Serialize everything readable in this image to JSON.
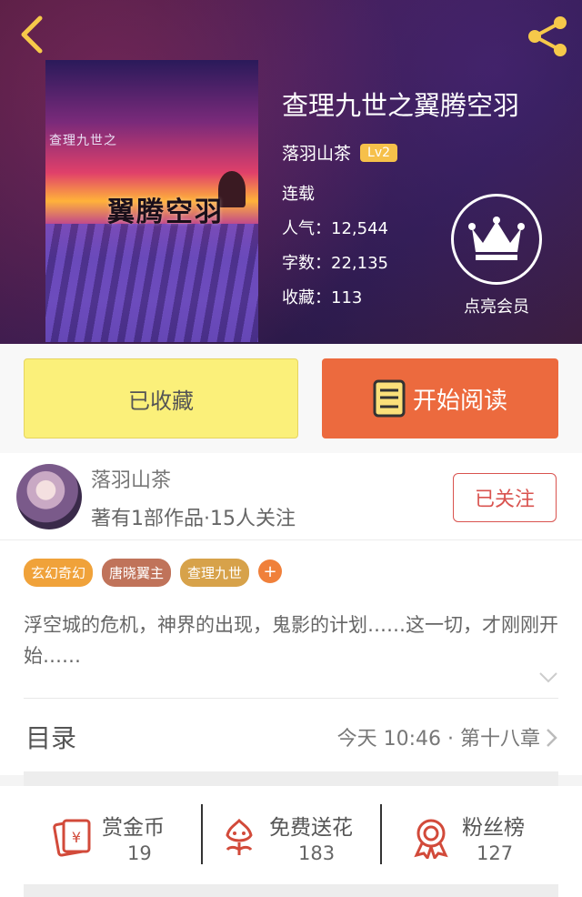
{
  "header": {
    "back_icon": "chevron-left-icon",
    "share_icon": "share-icon"
  },
  "book": {
    "cover_subtitle": "查理九世之",
    "cover_title": "翼腾空羽",
    "title": "查理九世之翼腾空羽",
    "author": "落羽山茶",
    "level": "Lv2",
    "status": "连载",
    "popularity": "人气：12,544",
    "word_count": "字数：22,135",
    "favorites": "收藏：113"
  },
  "vip": {
    "icon": "crown-icon",
    "label": "点亮会员"
  },
  "actions": {
    "collected_label": "已收藏",
    "read_label": "开始阅读",
    "read_icon": "book-icon"
  },
  "author_panel": {
    "name": "落羽山茶",
    "meta": "著有1部作品·15人关注",
    "follow_label": "已关注"
  },
  "tags": [
    {
      "label": "玄幻奇幻",
      "color": "#f0a23a"
    },
    {
      "label": "唐晓翼主",
      "color": "#c0735a"
    },
    {
      "label": "查理九世",
      "color": "#d7a24a"
    }
  ],
  "tag_add": "+",
  "description": "浮空城的危机，神界的出现，鬼影的计划……这一切，才刚刚开始……",
  "toc": {
    "label": "目录",
    "latest": "今天 10:46 · 第十八章"
  },
  "stats": [
    {
      "title": "赏金币",
      "count": "19",
      "icon": "red-envelope-icon"
    },
    {
      "title": "免费送花",
      "count": "183",
      "icon": "flower-icon"
    },
    {
      "title": "粉丝榜",
      "count": "127",
      "icon": "medal-icon"
    }
  ],
  "colors": {
    "accent_orange": "#ec6a3e",
    "collected_yellow": "#fbf07a",
    "follow_red": "#d9534f",
    "lv_badge": "#f6c04a"
  }
}
